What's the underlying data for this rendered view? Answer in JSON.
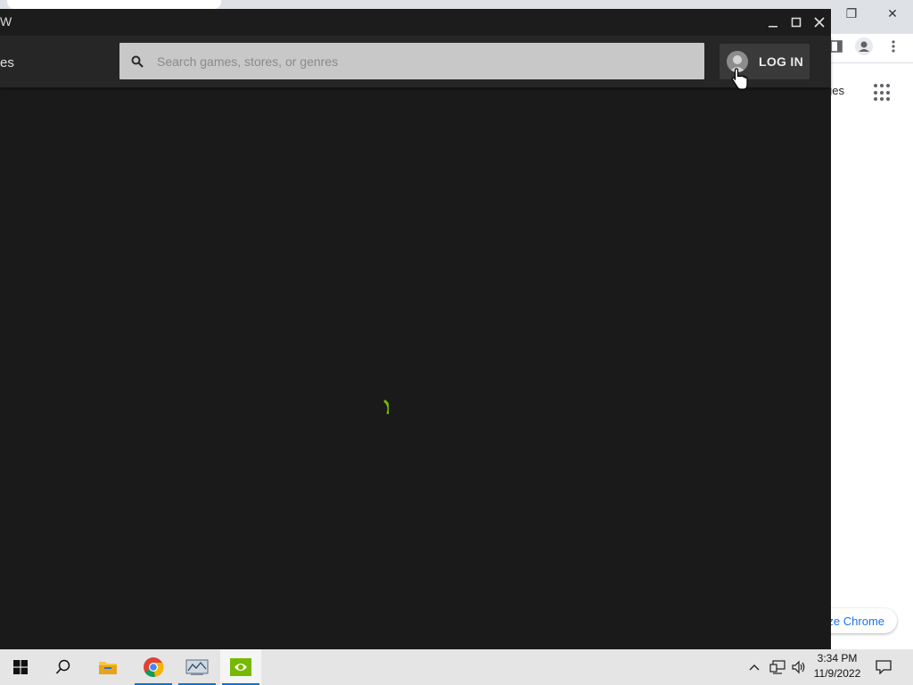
{
  "chrome": {
    "images_link": "ges",
    "customize_label": "ze Chrome",
    "window_buttons": {
      "restore": "❐",
      "close": "✕"
    }
  },
  "gfn": {
    "title": "W",
    "nav_fragment": "es",
    "search": {
      "placeholder": "Search games, stores, or genres",
      "value": ""
    },
    "login_label": "LOG IN",
    "accent_color": "#76b900",
    "window_buttons": {
      "minimize": "—",
      "maximize": "☐",
      "close": "✕"
    }
  },
  "taskbar": {
    "apps": [
      {
        "name": "Start",
        "icon": "windows-logo-icon"
      },
      {
        "name": "Search",
        "icon": "search-icon"
      },
      {
        "name": "File Explorer",
        "icon": "folder-icon"
      },
      {
        "name": "Google Chrome",
        "icon": "chrome-icon"
      },
      {
        "name": "Network viewer",
        "icon": "network-app-icon"
      },
      {
        "name": "GeForce NOW",
        "icon": "nvidia-icon"
      }
    ],
    "clock": {
      "time": "3:34 PM",
      "date": "11/9/2022"
    }
  }
}
